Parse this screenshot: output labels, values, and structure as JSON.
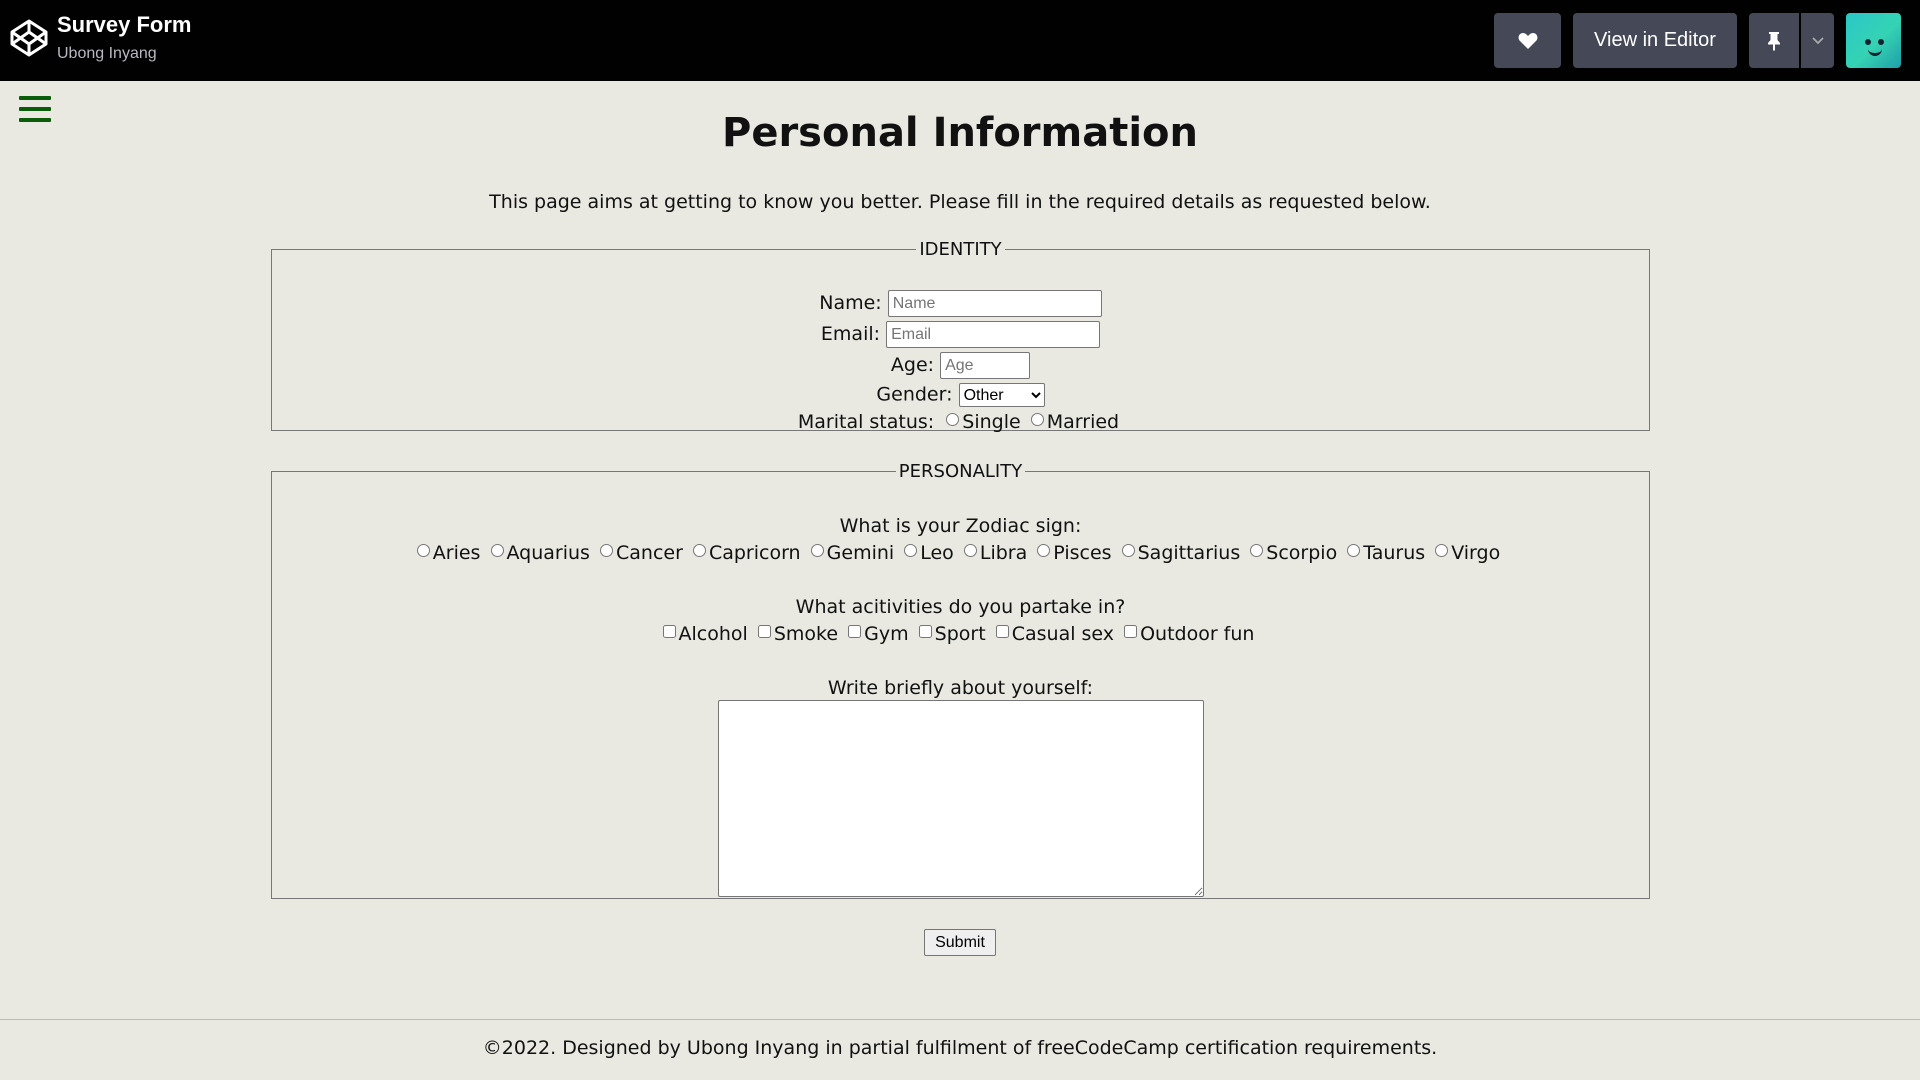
{
  "header": {
    "title": "Survey Form",
    "author": "Ubong Inyang",
    "view_editor_label": "View in Editor",
    "heart_icon": "heart-icon",
    "pin_icon": "pin-icon"
  },
  "main": {
    "title": "Personal Information",
    "intro": "This page aims at getting to know you better. Please fill in the required details as requested below."
  },
  "identity": {
    "legend": "IDENTITY",
    "name_label": "Name:",
    "name_placeholder": "Name",
    "email_label": "Email:",
    "email_placeholder": "Email",
    "age_label": "Age:",
    "age_placeholder": "Age",
    "gender_label": "Gender:",
    "gender_selected": "Other",
    "marital_label": "Marital status:",
    "marital_options": [
      "Single",
      "Married"
    ]
  },
  "personality": {
    "legend": "PERSONALITY",
    "zodiac_question": "What is your Zodiac sign:",
    "zodiac_options": [
      "Aries",
      "Aquarius",
      "Cancer",
      "Capricorn",
      "Gemini",
      "Leo",
      "Libra",
      "Pisces",
      "Sagittarius",
      "Scorpio",
      "Taurus",
      "Virgo"
    ],
    "activities_question": "What acitivities do you partake in?",
    "activities_options": [
      "Alcohol",
      "Smoke",
      "Gym",
      "Sport",
      "Casual sex",
      "Outdoor fun"
    ],
    "about_label": "Write briefly about yourself:"
  },
  "submit_label": "Submit",
  "footer": "©2022. Designed by Ubong Inyang in partial fulfilment of freeCodeCamp certification requirements.",
  "colors": {
    "topbar": "#010101",
    "button": "#444857",
    "page_bg": "#e9e9e2",
    "menu_icon": "#0a5c0a"
  }
}
